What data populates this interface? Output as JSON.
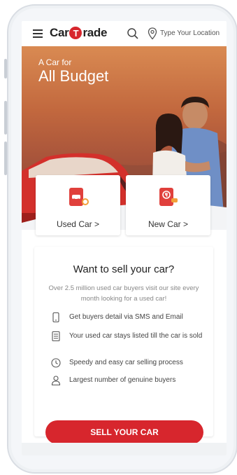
{
  "header": {
    "logo_left": "Car",
    "logo_badge": "T",
    "logo_right": "rade",
    "location_placeholder": "Type Your Location"
  },
  "hero": {
    "tagline_small": "A Car for",
    "tagline_big": "All Budget"
  },
  "cards": [
    {
      "label": "Used Car",
      "icon": "used-car-icon",
      "chevron": ">"
    },
    {
      "label": "New Car",
      "icon": "new-car-icon",
      "chevron": ">"
    }
  ],
  "sell": {
    "title": "Want to sell your car?",
    "subtitle": "Over 2.5 million used car buyers visit our site every month looking for a used car!",
    "features": [
      {
        "icon": "phone-icon",
        "text": "Get buyers detail via SMS and Email"
      },
      {
        "icon": "list-icon",
        "text": "Your used car stays listed till the car is sold"
      },
      {
        "icon": "clock-icon",
        "text": "Speedy and easy car selling process"
      },
      {
        "icon": "user-icon",
        "text": "Largest number of genuine buyers"
      }
    ],
    "button_label": "SELL YOUR CAR"
  },
  "colors": {
    "brand_red": "#d7262d",
    "hero_orange": "#c2683e"
  }
}
